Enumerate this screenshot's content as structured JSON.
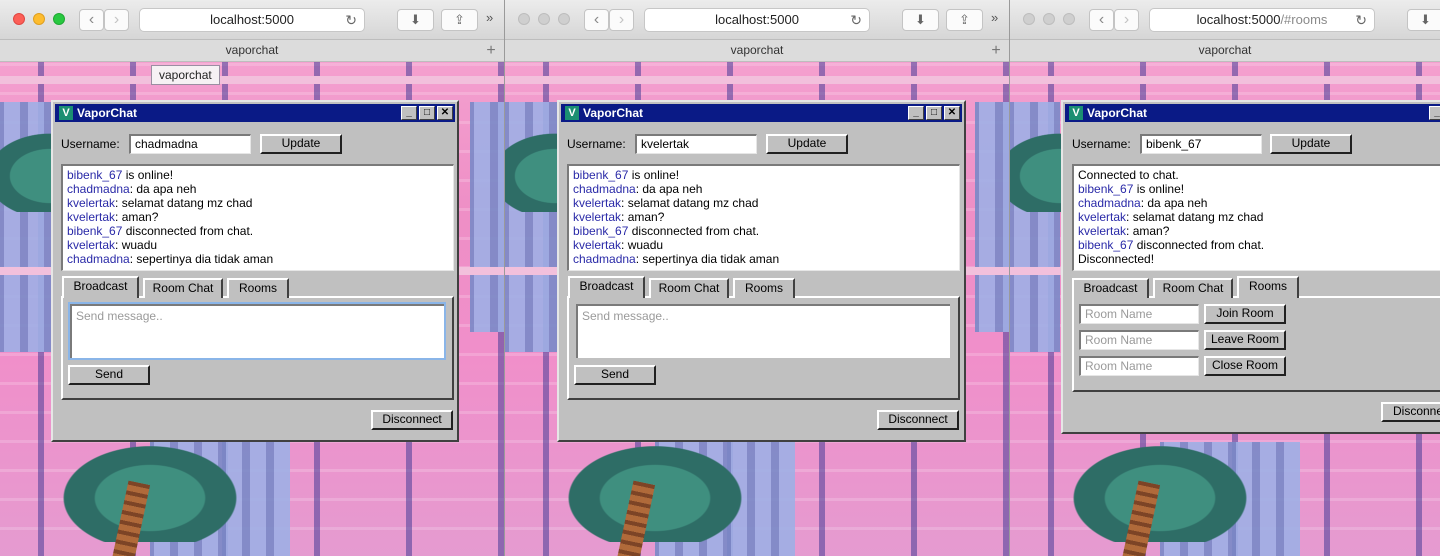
{
  "browsers": [
    {
      "url": "localhost:5000",
      "url_suffix": "",
      "tab_title": "vaporchat",
      "badge": "vaporchat",
      "window": {
        "title": "VaporChat",
        "username_label": "Username:",
        "username": "chadmadna",
        "update_label": "Update",
        "log": [
          {
            "user": "bibenk_67",
            "text": " is online!"
          },
          {
            "user": "chadmadna",
            "text": ": da apa neh"
          },
          {
            "user": "kvelertak",
            "text": ": selamat datang mz chad"
          },
          {
            "user": "kvelertak",
            "text": ": aman?"
          },
          {
            "user": "bibenk_67",
            "text": " disconnected from chat."
          },
          {
            "user": "kvelertak",
            "text": ": wuadu"
          },
          {
            "user": "chadmadna",
            "text": ": sepertinya dia tidak aman"
          }
        ],
        "tabs": [
          "Broadcast",
          "Room Chat",
          "Rooms"
        ],
        "active_tab": 0,
        "message_placeholder": "Send message..",
        "send_label": "Send",
        "disconnect_label": "Disconnect"
      }
    },
    {
      "url": "localhost:5000",
      "url_suffix": "",
      "tab_title": "vaporchat",
      "window": {
        "title": "VaporChat",
        "username_label": "Username:",
        "username": "kvelertak",
        "update_label": "Update",
        "log": [
          {
            "user": "bibenk_67",
            "text": " is online!"
          },
          {
            "user": "chadmadna",
            "text": ": da apa neh"
          },
          {
            "user": "kvelertak",
            "text": ": selamat datang mz chad"
          },
          {
            "user": "kvelertak",
            "text": ": aman?"
          },
          {
            "user": "bibenk_67",
            "text": " disconnected from chat."
          },
          {
            "user": "kvelertak",
            "text": ": wuadu"
          },
          {
            "user": "chadmadna",
            "text": ": sepertinya dia tidak aman"
          }
        ],
        "tabs": [
          "Broadcast",
          "Room Chat",
          "Rooms"
        ],
        "active_tab": 0,
        "message_placeholder": "Send message..",
        "send_label": "Send",
        "disconnect_label": "Disconnect"
      }
    },
    {
      "url": "localhost:5000",
      "url_suffix": "/#rooms",
      "tab_title": "vaporchat",
      "window": {
        "title": "VaporChat",
        "username_label": "Username:",
        "username": "bibenk_67",
        "update_label": "Update",
        "log": [
          {
            "user": "",
            "text": "Connected to chat."
          },
          {
            "user": "bibenk_67",
            "text": " is online!"
          },
          {
            "user": "chadmadna",
            "text": ": da apa neh"
          },
          {
            "user": "kvelertak",
            "text": ": selamat datang mz chad"
          },
          {
            "user": "kvelertak",
            "text": ": aman?"
          },
          {
            "user": "bibenk_67",
            "text": " disconnected from chat."
          },
          {
            "user": "",
            "text": "Disconnected!"
          }
        ],
        "tabs": [
          "Broadcast",
          "Room Chat",
          "Rooms"
        ],
        "active_tab": 2,
        "room_placeholder": "Room Name",
        "room_actions": [
          "Join Room",
          "Leave Room",
          "Close Room"
        ],
        "disconnect_label": "Disconnec"
      }
    }
  ],
  "colors": {
    "titlebar": "#0a1a86",
    "username_link": "#2a2aa8",
    "window_face": "#c0c0c0"
  }
}
